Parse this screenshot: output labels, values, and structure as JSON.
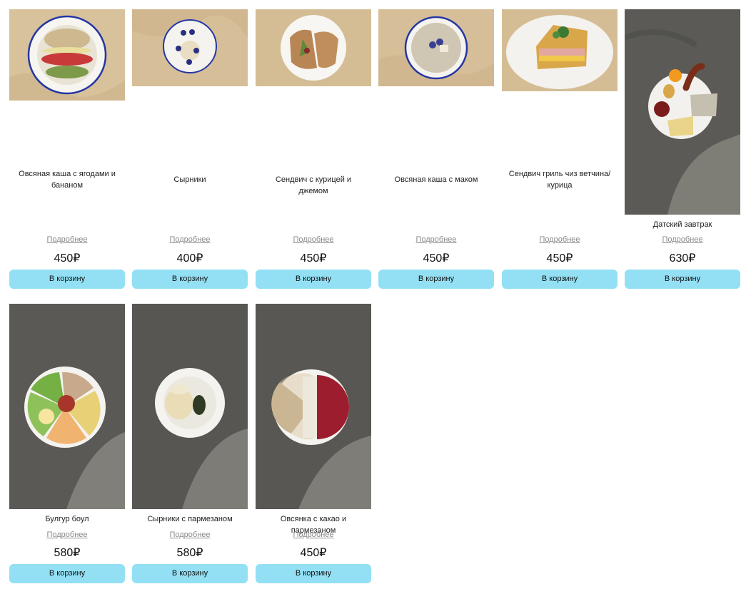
{
  "currency": "₽",
  "colors": {
    "button": "#93e0f5",
    "link": "#8a8a8a",
    "plate_rim_blue": "#2436a3",
    "beige_cloth": "#d6bf98",
    "concrete": "#5a5955"
  },
  "products": [
    {
      "name": "Овсяная каша с ягодами и бананом",
      "more": "Подробнее",
      "price": "450",
      "button": "В корзину",
      "photo": "oatmeal-berries-banana-photo"
    },
    {
      "name": "Сырники",
      "more": "Подробнее",
      "price": "400",
      "button": "В корзину",
      "photo": "syrniki-photo"
    },
    {
      "name": "Сендвич с курицей и джемом",
      "more": "Подробнее",
      "price": "450",
      "button": "В корзину",
      "photo": "sandwich-chicken-jam-photo"
    },
    {
      "name": "Овсяная каша с маком",
      "more": "Подробнее",
      "price": "450",
      "button": "В корзину",
      "photo": "oatmeal-poppy-photo"
    },
    {
      "name": "Сендвич гриль чиз ветчина/курица",
      "more": "Подробнее",
      "price": "450",
      "button": "В корзину",
      "photo": "grilled-cheese-sandwich-photo"
    },
    {
      "name": "Датский завтрак",
      "more": "Подробнее",
      "price": "630",
      "button": "В корзину",
      "photo": "danish-breakfast-photo"
    },
    {
      "name": "Булгур боул",
      "more": "Подробнее",
      "price": "580",
      "button": "В корзину",
      "photo": "bulgur-bowl-photo"
    },
    {
      "name": "Сырники с пармезаном",
      "more": "Подробнее",
      "price": "580",
      "button": "В корзину",
      "photo": "syrniki-parmesan-photo"
    },
    {
      "name": "Овсянка с какао и пармезаном",
      "more": "Подробнее",
      "price": "450",
      "button": "В корзину",
      "photo": "oatmeal-cocoa-parmesan-photo"
    }
  ]
}
